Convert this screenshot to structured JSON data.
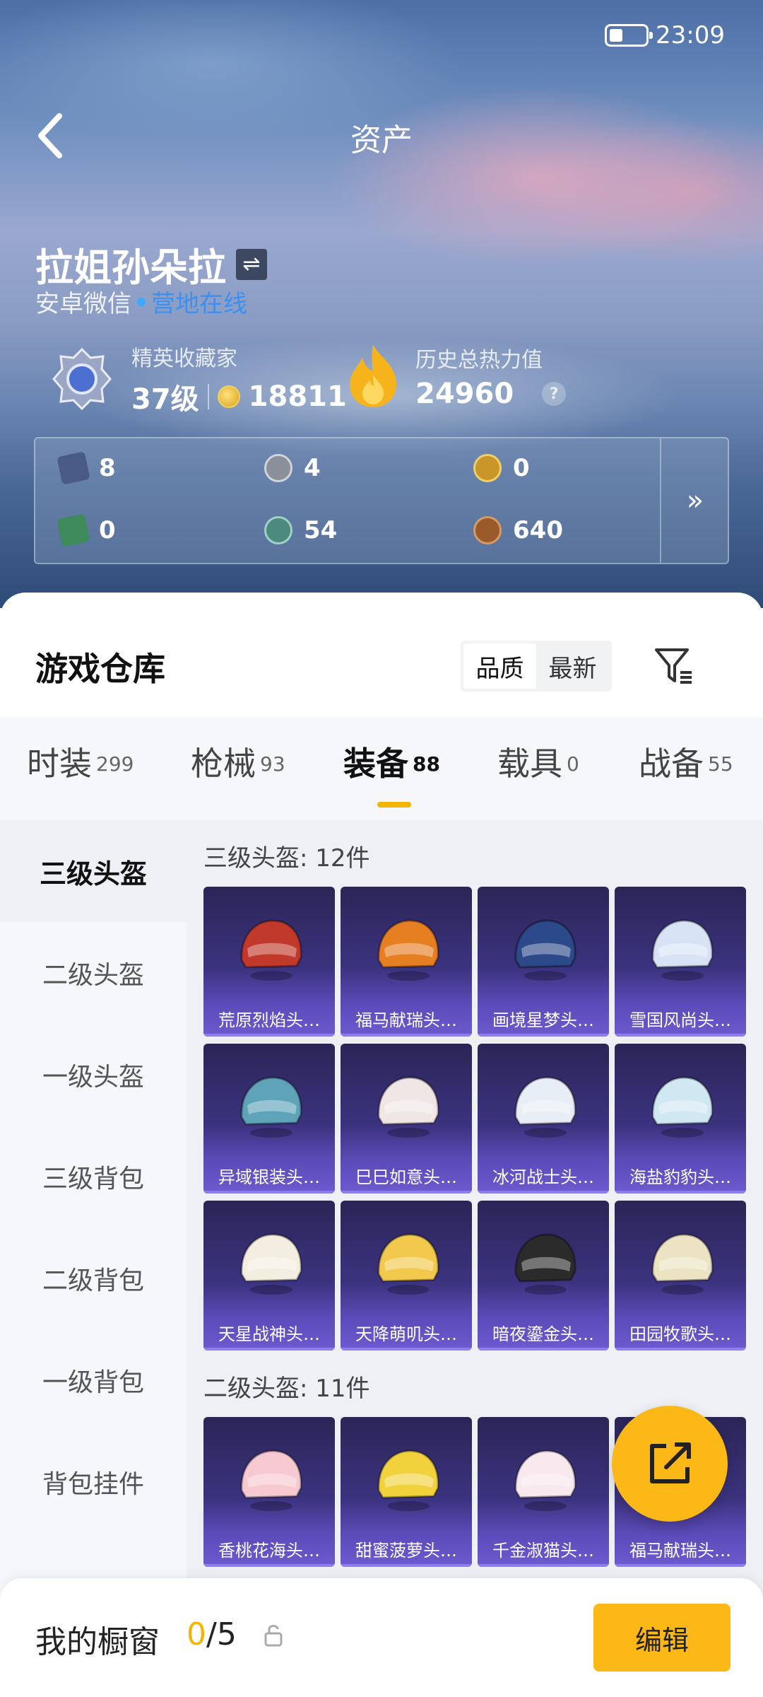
{
  "status_bar": {
    "time": "23:09"
  },
  "header": {
    "title": "资产"
  },
  "profile": {
    "name": "拉姐孙朵拉",
    "platform": "安卓微信",
    "online_status": "营地在线"
  },
  "stats": {
    "collector": {
      "label": "精英收藏家",
      "level": "37级",
      "points": "18811"
    },
    "heat": {
      "label": "历史总热力值",
      "value": "24960",
      "help": "?"
    }
  },
  "currencies": [
    {
      "icon": "card-icon",
      "value": "8",
      "color": "#4a5a86"
    },
    {
      "icon": "silver-coin-icon",
      "value": "4",
      "color": "#8a8f9a"
    },
    {
      "icon": "gold-coin-icon",
      "value": "0",
      "color": "#c9962a"
    },
    {
      "icon": "green-card-icon",
      "value": "0",
      "color": "#3f8a5a"
    },
    {
      "icon": "gem-icon",
      "value": "54",
      "color": "#4c8a7e"
    },
    {
      "icon": "bronze-coin-icon",
      "value": "640",
      "color": "#9a5a2a"
    }
  ],
  "panel": {
    "more": "»"
  },
  "warehouse": {
    "title": "游戏仓库",
    "sort_options": [
      "品质",
      "最新"
    ],
    "tabs": [
      {
        "label": "时装",
        "count": "299"
      },
      {
        "label": "枪械",
        "count": "93"
      },
      {
        "label": "装备",
        "count": "88"
      },
      {
        "label": "载具",
        "count": "0"
      },
      {
        "label": "战备",
        "count": "55"
      }
    ],
    "categories": [
      "三级头盔",
      "二级头盔",
      "一级头盔",
      "三级背包",
      "二级背包",
      "一级背包",
      "背包挂件"
    ],
    "sections": [
      {
        "title": "三级头盔: 12件",
        "items": [
          "荒原烈焰头…",
          "福马献瑞头…",
          "画境星梦头…",
          "雪国风尚头…",
          "异域银装头…",
          "巳巳如意头…",
          "冰河战士头…",
          "海盐豹豹头…",
          "天星战神头…",
          "天降萌叽头…",
          "暗夜鎏金头…",
          "田园牧歌头…"
        ]
      },
      {
        "title": "二级头盔: 11件",
        "items": [
          "香桃花海头…",
          "甜蜜菠萝头…",
          "千金淑猫头…",
          "福马献瑞头…"
        ]
      }
    ],
    "helmet_colors": [
      "#c0392b",
      "#e67e22",
      "#2c4a8a",
      "#d7e3f4",
      "#5fa3b8",
      "#f1e6e6",
      "#e8eef6",
      "#cfe8f2",
      "#f3eee0",
      "#f2c94c",
      "#2b2b2b",
      "#ece3c2",
      "#f7c9d0",
      "#f2d23c",
      "#f7e9ee",
      "#f5d84a"
    ]
  },
  "showcase": {
    "label": "我的橱窗",
    "current": "0",
    "total": "/5",
    "edit_label": "编辑"
  }
}
